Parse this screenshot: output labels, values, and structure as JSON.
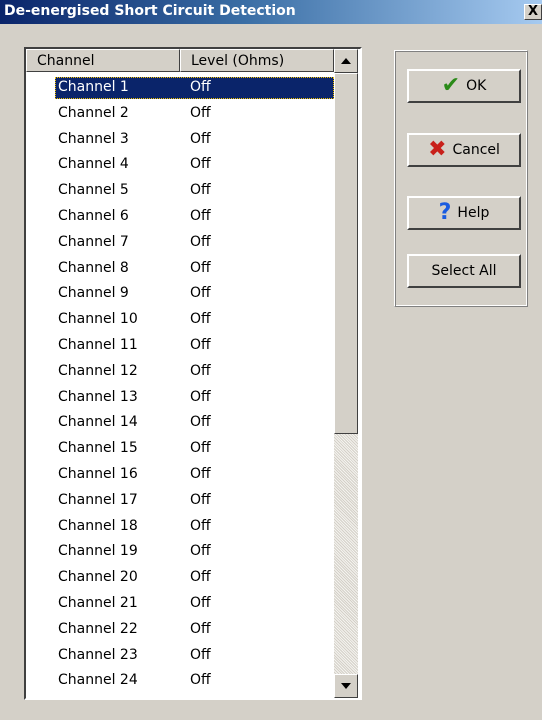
{
  "window": {
    "title": "De-energised Short Circuit Detection",
    "close_label": "X"
  },
  "list": {
    "columns": [
      "Channel",
      "Level (Ohms)"
    ],
    "selected_index": 0,
    "rows": [
      {
        "channel": "Channel 1",
        "level": "Off"
      },
      {
        "channel": "Channel 2",
        "level": "Off"
      },
      {
        "channel": "Channel 3",
        "level": "Off"
      },
      {
        "channel": "Channel 4",
        "level": "Off"
      },
      {
        "channel": "Channel 5",
        "level": "Off"
      },
      {
        "channel": "Channel 6",
        "level": "Off"
      },
      {
        "channel": "Channel 7",
        "level": "Off"
      },
      {
        "channel": "Channel 8",
        "level": "Off"
      },
      {
        "channel": "Channel 9",
        "level": "Off"
      },
      {
        "channel": "Channel 10",
        "level": "Off"
      },
      {
        "channel": "Channel 11",
        "level": "Off"
      },
      {
        "channel": "Channel 12",
        "level": "Off"
      },
      {
        "channel": "Channel 13",
        "level": "Off"
      },
      {
        "channel": "Channel 14",
        "level": "Off"
      },
      {
        "channel": "Channel 15",
        "level": "Off"
      },
      {
        "channel": "Channel 16",
        "level": "Off"
      },
      {
        "channel": "Channel 17",
        "level": "Off"
      },
      {
        "channel": "Channel 18",
        "level": "Off"
      },
      {
        "channel": "Channel 19",
        "level": "Off"
      },
      {
        "channel": "Channel 20",
        "level": "Off"
      },
      {
        "channel": "Channel 21",
        "level": "Off"
      },
      {
        "channel": "Channel 22",
        "level": "Off"
      },
      {
        "channel": "Channel 23",
        "level": "Off"
      },
      {
        "channel": "Channel 24",
        "level": "Off"
      }
    ]
  },
  "buttons": {
    "ok": {
      "label": "OK",
      "icon": "checkmark-icon"
    },
    "cancel": {
      "label": "Cancel",
      "icon": "x-icon"
    },
    "help": {
      "label": "Help",
      "icon": "question-icon"
    },
    "select_all": {
      "label": "Select All"
    }
  },
  "colors": {
    "title_bar": "#0a246a",
    "selection": "#0a246a",
    "dialog_bg": "#d4d0c8",
    "ok_icon": "#2a8a18",
    "cancel_icon": "#c8201a",
    "help_icon": "#1a5ce0"
  }
}
